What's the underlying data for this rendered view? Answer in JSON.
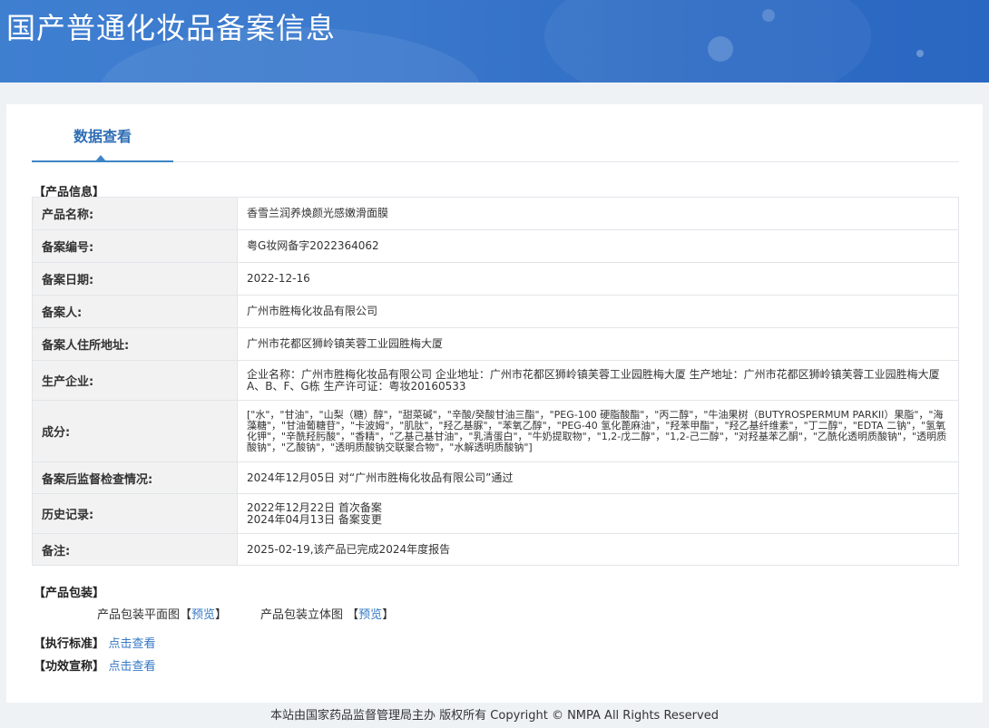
{
  "header": {
    "title": "国产普通化妆品备案信息"
  },
  "tabs": [
    {
      "label": "数据查看"
    }
  ],
  "product_info": {
    "section_label": "【产品信息】",
    "rows": [
      {
        "key": "产品名称:",
        "value": "香雪兰润养焕颜光感嫩滑面膜"
      },
      {
        "key": "备案编号:",
        "value": "粤G妆网备字2022364062"
      },
      {
        "key": "备案日期:",
        "value": "2022-12-16"
      },
      {
        "key": "备案人:",
        "value": "广州市胜梅化妆品有限公司"
      },
      {
        "key": "备案人住所地址:",
        "value": "广州市花都区狮岭镇芙蓉工业园胜梅大厦"
      },
      {
        "key": "生产企业:",
        "value": "企业名称：广州市胜梅化妆品有限公司 企业地址：广州市花都区狮岭镇芙蓉工业园胜梅大厦 生产地址：广州市花都区狮岭镇芙蓉工业园胜梅大厦A、B、F、G栋 生产许可证：粤妆20160533"
      },
      {
        "key": "成分:",
        "value": "[\"水\"，\"甘油\"，\"山梨（糖）醇\"，\"甜菜碱\"，\"辛酸/癸酸甘油三酯\"，\"PEG-100 硬脂酸酯\"，\"丙二醇\"，\"牛油果树（BUTYROSPERMUM PARKII）果脂\"，\"海藻糖\"，\"甘油葡糖苷\"，\"卡波姆\"，\"肌肽\"，\"羟乙基脲\"，\"苯氧乙醇\"，\"PEG-40 氢化蓖麻油\"，\"羟苯甲酯\"，\"羟乙基纤维素\"，\"丁二醇\"，\"EDTA 二钠\"，\"氢氧化钾\"，\"辛酰羟肟酸\"，\"香精\"，\"乙基己基甘油\"，\"乳清蛋白\"，\"牛奶提取物\"，\"1,2-戊二醇\"，\"1,2-己二醇\"，\"对羟基苯乙酮\"，\"乙酰化透明质酸钠\"，\"透明质酸钠\"，\"乙酸钠\"，\"透明质酸钠交联聚合物\"，\"水解透明质酸钠\"]"
      },
      {
        "key": "备案后监督检查情况:",
        "value": "2024年12月05日 对“广州市胜梅化妆品有限公司”通过"
      },
      {
        "key": "历史记录:",
        "value_lines": [
          "2022年12月22日 首次备案",
          "2024年04月13日 备案变更"
        ]
      },
      {
        "key": "备注:",
        "value": "2025-02-19,该产品已完成2024年度报告"
      }
    ]
  },
  "packaging": {
    "section_label": "【产品包装】",
    "flat_label": "产品包装平面图",
    "solid_label": "产品包装立体图",
    "bracket_open": "【",
    "bracket_close": "】",
    "preview_link": "预览"
  },
  "standard": {
    "label": "【执行标准】",
    "link": "点击查看"
  },
  "efficacy": {
    "label": "【功效宣称】",
    "link": "点击查看"
  },
  "footer": {
    "text": "本站由国家药品监督管理局主办 版权所有 Copyright © NMPA All Rights Reserved"
  }
}
